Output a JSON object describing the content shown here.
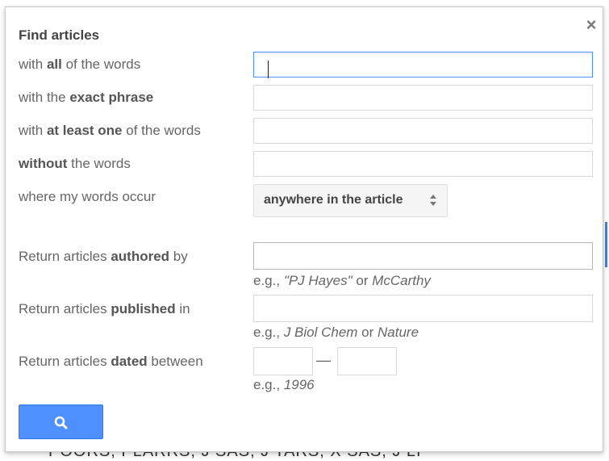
{
  "background": {
    "text": "POORS, PLARRS, J SAS, J TARS, X SAS, J LI"
  },
  "dialog": {
    "title": "Find articles",
    "close_symbol": "×",
    "rows": [
      {
        "pre": "with ",
        "bold": "all",
        "post": " of the words",
        "value": ""
      },
      {
        "pre": "with the ",
        "bold": "exact phrase",
        "post": "",
        "value": ""
      },
      {
        "pre": "with ",
        "bold": "at least one",
        "post": " of the words",
        "value": ""
      },
      {
        "pre": "",
        "bold": "without",
        "post": " the words",
        "value": ""
      }
    ],
    "occur": {
      "label": "where my words occur",
      "selected": "anywhere in the article"
    },
    "authored": {
      "pre": "Return articles ",
      "bold": "authored",
      "post": " by",
      "value": "",
      "hint_prefix": "e.g., ",
      "hint_ex1": "\"PJ Hayes\"",
      "hint_mid": " or ",
      "hint_ex2": "McCarthy"
    },
    "published": {
      "pre": "Return articles ",
      "bold": "published",
      "post": " in",
      "value": "",
      "hint_prefix": "e.g., ",
      "hint_ex1": "J Biol Chem",
      "hint_mid": " or ",
      "hint_ex2": "Nature"
    },
    "dated": {
      "pre": "Return articles ",
      "bold": "dated",
      "post": " between",
      "from": "",
      "to": "",
      "dash": "—",
      "hint_prefix": "e.g., ",
      "hint_ex": "1996"
    },
    "search_button": {
      "icon": "search-icon",
      "color": "#4d90fe"
    }
  }
}
